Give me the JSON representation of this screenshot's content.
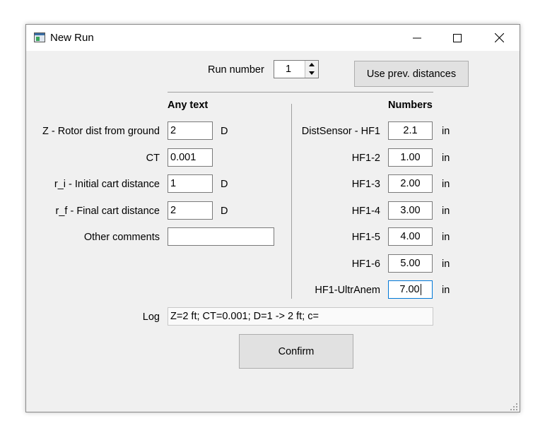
{
  "window": {
    "title": "New Run",
    "icons": {
      "app": "app-window-icon",
      "minimize": "minimize-icon",
      "maximize": "maximize-icon",
      "close": "close-icon"
    }
  },
  "run_number": {
    "label": "Run number",
    "value": "1"
  },
  "use_prev_button": "Use prev. distances",
  "left": {
    "header": "Any text",
    "fields": [
      {
        "label": "Z - Rotor dist from ground",
        "value": "2",
        "unit": "D"
      },
      {
        "label": "CT",
        "value": "0.001",
        "unit": ""
      },
      {
        "label": "r_i - Initial cart distance",
        "value": "1",
        "unit": "D"
      },
      {
        "label": "r_f - Final cart distance",
        "value": "2",
        "unit": "D"
      },
      {
        "label": "Other comments",
        "value": "",
        "unit": ""
      }
    ]
  },
  "right": {
    "header": "Numbers",
    "fields": [
      {
        "label": "DistSensor - HF1",
        "value": "2.1",
        "unit": "in"
      },
      {
        "label": "HF1-2",
        "value": "1.00",
        "unit": "in"
      },
      {
        "label": "HF1-3",
        "value": "2.00",
        "unit": "in"
      },
      {
        "label": "HF1-4",
        "value": "3.00",
        "unit": "in"
      },
      {
        "label": "HF1-5",
        "value": "4.00",
        "unit": "in"
      },
      {
        "label": "HF1-6",
        "value": "5.00",
        "unit": "in"
      },
      {
        "label": "HF1-UltrAnem",
        "value": "7.00",
        "unit": "in"
      }
    ]
  },
  "log": {
    "label": "Log",
    "value": "Z=2 ft; CT=0.001; D=1 -> 2 ft; c="
  },
  "confirm_button": "Confirm"
}
